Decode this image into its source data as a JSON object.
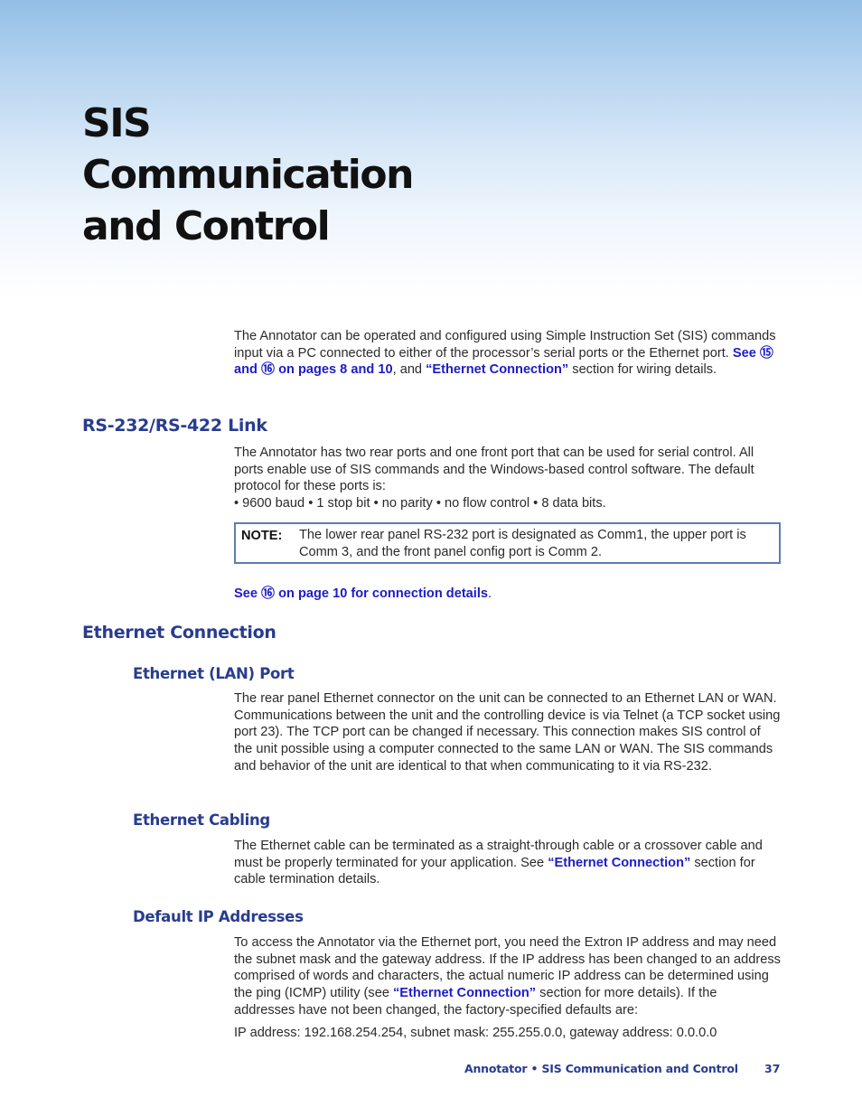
{
  "banner": {
    "title_lines": [
      "SIS",
      "Communication",
      "and Control"
    ]
  },
  "intro": {
    "text_1": "The Annotator can be operated and configured using Simple Instruction Set (SIS) commands input via a PC connected to either of the processor’s serial ports or the Ethernet port. ",
    "link_1_see": "See ",
    "link_1_num_a": "⑮",
    "link_1_and": " and ",
    "link_1_num_b": "⑯",
    "link_1_rest": " on pages 8 and 10",
    "text_2": ", and ",
    "link_2": "“Ethernet Connection”",
    "text_3": " section for wiring details."
  },
  "rs232": {
    "heading": "RS-232/RS-422 Link",
    "paragraph": "The Annotator has two rear ports and one front port that can be used for serial control. All ports enable use of SIS commands and the Windows-based control software. The default protocol for these ports is:",
    "protocol": "• 9600 baud • 1 stop bit • no parity • no flow control • 8 data bits.",
    "note_label": "NOTE:",
    "note_text": "The lower rear panel RS-232 port is designated as Comm1, the upper port is Comm 3, and the front panel config port is Comm 2.",
    "see_link_see": "See ",
    "see_link_num": "⑯",
    "see_link_rest": " on page 10 for connection details",
    "see_link_period": "."
  },
  "ethernet": {
    "heading": "Ethernet Connection",
    "lan_port": {
      "heading": "Ethernet (LAN) Port",
      "paragraph": "The rear panel Ethernet connector on the unit can be connected to an Ethernet LAN or WAN. Communications between the unit and the controlling device is via Telnet (a TCP socket using port 23). The TCP port can be changed if necessary. This connection makes SIS control of the unit possible using a computer connected to the same LAN or WAN. The SIS commands and behavior of the unit are identical to that when communicating to it via RS-232."
    },
    "cabling": {
      "heading": "Ethernet Cabling",
      "text_1": "The Ethernet cable can be terminated as a straight-through cable or a crossover cable and must be properly terminated for your application. See ",
      "link": "“Ethernet Connection”",
      "text_2": " section for cable termination details."
    },
    "default_ip": {
      "heading": "Default IP Addresses",
      "text_1": "To access the Annotator via the Ethernet port, you need the Extron IP address and may need the subnet mask and the gateway address. If the IP address has been changed to an address comprised of words and characters, the actual numeric IP address can be determined using the ping (ICMP) utility (see ",
      "link": "“Ethernet Connection”",
      "text_2": " section for more details). If the addresses have not been changed, the factory-specified defaults are:",
      "defaults": "IP address: 192.168.254.254, subnet mask: 255.255.0.0, gateway address: 0.0.0.0"
    }
  },
  "footer": {
    "label": "Annotator • SIS Communication and Control",
    "page": "37"
  }
}
